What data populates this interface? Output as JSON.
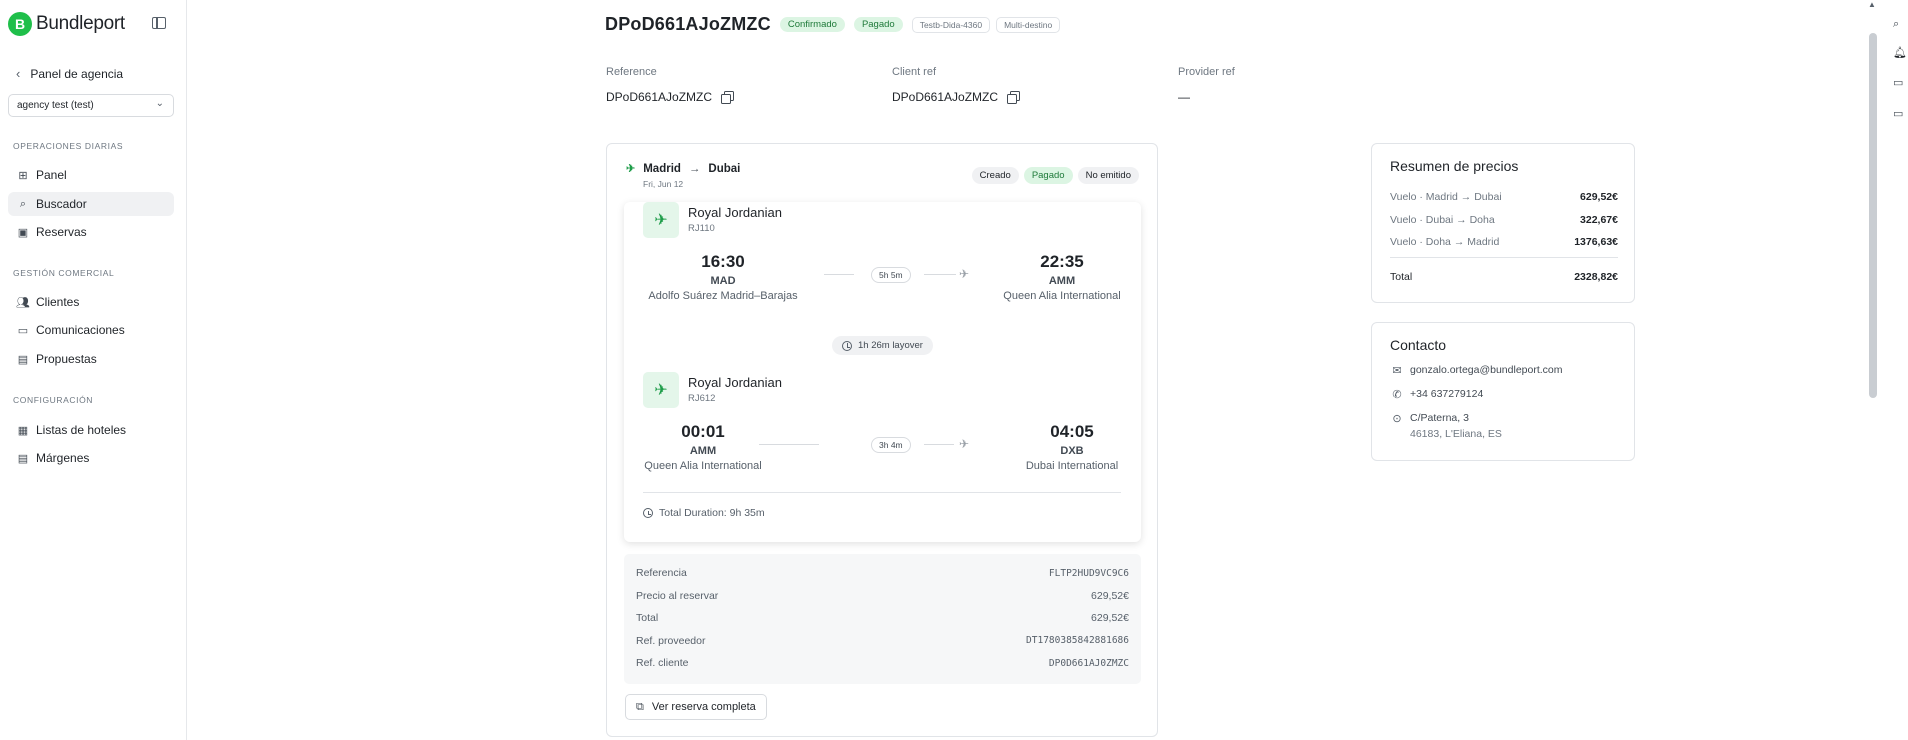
{
  "brand": {
    "logo_letter": "B",
    "name": "Bundleport"
  },
  "sidebar": {
    "back_label": "Panel de agencia",
    "agency": "agency test (test)",
    "sections": [
      {
        "title": "OPERACIONES DIARIAS",
        "items": [
          {
            "label": "Panel",
            "icon": "dashboard-icon"
          },
          {
            "label": "Buscador",
            "icon": "search-icon",
            "active": true
          },
          {
            "label": "Reservas",
            "icon": "calendar-icon"
          }
        ]
      },
      {
        "title": "GESTIÓN COMERCIAL",
        "items": [
          {
            "label": "Clientes",
            "icon": "users-icon"
          },
          {
            "label": "Comunicaciones",
            "icon": "message-icon"
          },
          {
            "label": "Propuestas",
            "icon": "document-icon"
          }
        ]
      },
      {
        "title": "CONFIGURACIÓN",
        "items": [
          {
            "label": "Listas de hoteles",
            "icon": "list-icon"
          },
          {
            "label": "Márgenes",
            "icon": "document-icon"
          }
        ]
      }
    ]
  },
  "booking": {
    "title": "DPoD661AJoZMZC",
    "badges": [
      "Confirmado",
      "Pagado",
      "Testb-Dida-4360",
      "Multi-destino"
    ],
    "reference_label": "Reference",
    "reference_value": "DPoD661AJoZMZC",
    "client_ref_label": "Client ref",
    "client_ref_value": "DPoD661AJoZMZC",
    "provider_ref_label": "Provider ref",
    "provider_ref_value": "—"
  },
  "flight": {
    "origin": "Madrid",
    "destination": "Dubai",
    "date": "Fri, Jun 12",
    "statuses": [
      "Creado",
      "Pagado",
      "No emitido"
    ],
    "segments": [
      {
        "airline": "Royal Jordanian",
        "flight_no": "RJ110",
        "dep_time": "16:30",
        "dep_code": "MAD",
        "dep_name": "Adolfo Suárez Madrid–Barajas",
        "duration": "5h 5m",
        "arr_time": "22:35",
        "arr_code": "AMM",
        "arr_name": "Queen Alia International"
      },
      {
        "airline": "Royal Jordanian",
        "flight_no": "RJ612",
        "dep_time": "00:01",
        "dep_code": "AMM",
        "dep_name": "Queen Alia International",
        "duration": "3h 4m",
        "arr_time": "04:05",
        "arr_code": "DXB",
        "arr_name": "Dubai International"
      }
    ],
    "layover": "1h 26m layover",
    "total_duration": "Total Duration: 9h 35m",
    "details": [
      {
        "k": "Referencia",
        "v": "FLTP2HUD9VC9C6",
        "mono": true
      },
      {
        "k": "Precio al reservar",
        "v": "629,52€",
        "mono": false
      },
      {
        "k": "Total",
        "v": "629,52€",
        "mono": false
      },
      {
        "k": "Ref. proveedor",
        "v": "DT1780385842881686",
        "mono": true
      },
      {
        "k": "Ref. cliente",
        "v": "DP0D661AJ0ZMZC",
        "mono": true
      }
    ],
    "view_button": "Ver reserva completa"
  },
  "prices": {
    "title": "Resumen de precios",
    "rows": [
      {
        "k": "Vuelo · Madrid → Dubai",
        "v": "629,52€"
      },
      {
        "k": "Vuelo · Dubai → Doha",
        "v": "322,67€"
      },
      {
        "k": "Vuelo · Doha → Madrid",
        "v": "1376,63€"
      }
    ],
    "total_label": "Total",
    "total_value": "2328,82€"
  },
  "contact": {
    "title": "Contacto",
    "email": "gonzalo.ortega@bundleport.com",
    "phone": "+34 637279124",
    "address_line1": "C/Paterna, 3",
    "address_line2": "46183, L'Eliana, ES"
  },
  "colors": {
    "brand": "#1fbf4a",
    "success_bg": "#dcf5e3",
    "success_text": "#1f7a3a"
  }
}
